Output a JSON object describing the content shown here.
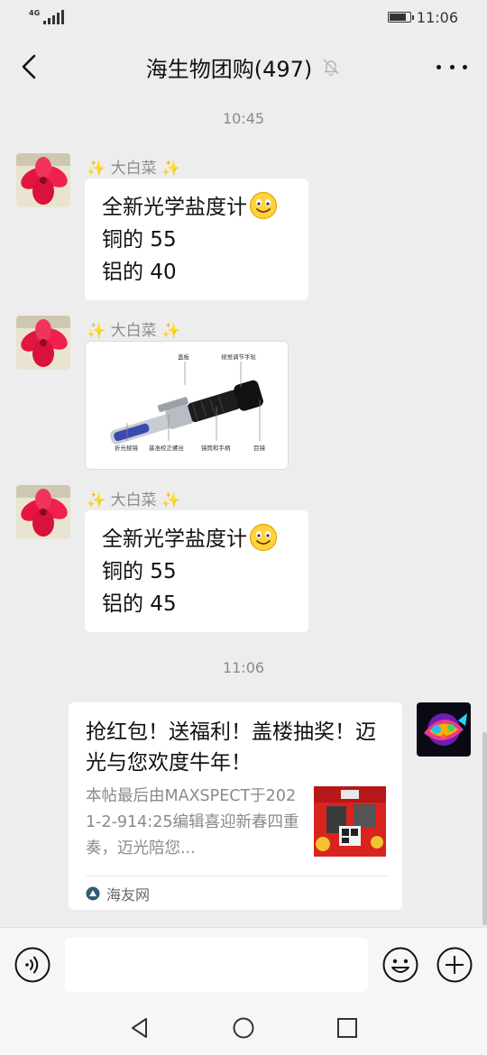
{
  "status_bar": {
    "network": "4G",
    "time": "11:06"
  },
  "header": {
    "title": "海生物团购(497)",
    "back_icon": "chevron-left-icon",
    "mute_icon": "bell-off-icon",
    "more_icon": "more-dots-icon"
  },
  "messages": {
    "time_1": "10:45",
    "msg_1": {
      "sender": "✨ 大白菜 ✨",
      "line_1": "全新光学盐度计",
      "line_2": "铜的 55",
      "line_3": "铝的 40"
    },
    "msg_2": {
      "sender": "✨ 大白菜 ✨",
      "image_labels": {
        "cover": "盖板",
        "focus": "视觉调节手轮",
        "prism": "折光棱镜",
        "calibration": "基准校正螺丝",
        "handle": "镜筒和手柄",
        "eyepiece": "目镜"
      }
    },
    "msg_3": {
      "sender": "✨ 大白菜 ✨",
      "line_1": "全新光学盐度计",
      "line_2": "铜的 55",
      "line_3": "铝的 45"
    },
    "time_2": "11:06",
    "link_card": {
      "title": "抢红包！送福利！盖楼抽奖！迈光与您欢度牛年！",
      "description": "本帖最后由MAXSPECT于2021-2-914:25编辑喜迎新春四重奏，迈光陪您...",
      "source": "海友网"
    }
  },
  "input_bar": {
    "voice_icon": "voice-icon",
    "placeholder": "",
    "emoji_icon": "emoji-icon",
    "plus_icon": "plus-circle-icon"
  },
  "system_nav": {
    "back_icon": "triangle-back-icon",
    "home_icon": "circle-home-icon",
    "recent_icon": "square-recent-icon"
  },
  "colors": {
    "chat_background": "#ededed",
    "bubble": "#ffffff",
    "secondary_text": "#8a8a8a"
  }
}
